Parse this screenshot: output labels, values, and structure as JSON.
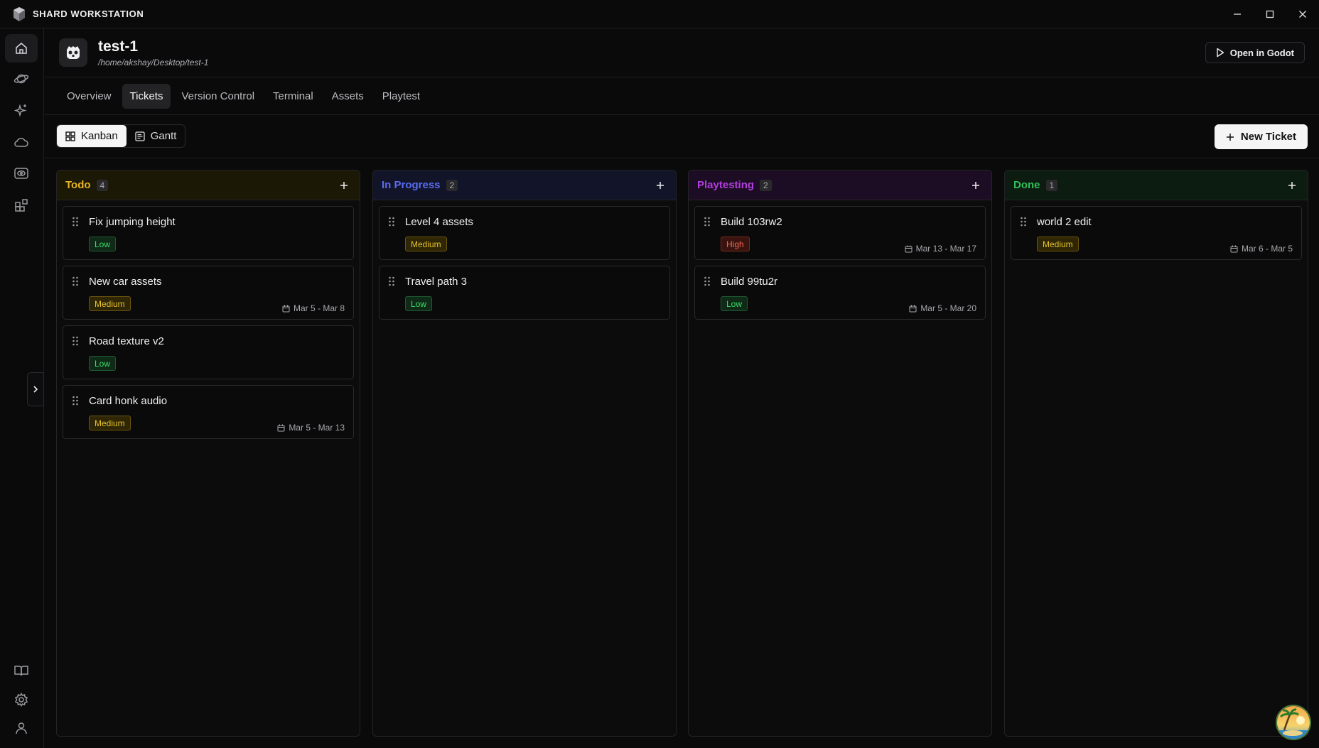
{
  "app": {
    "title": "SHARD WORKSTATION"
  },
  "project": {
    "name": "test-1",
    "path": "/home/akshay/Desktop/test-1",
    "open_label": "Open in Godot"
  },
  "tabs": [
    {
      "label": "Overview",
      "active": false
    },
    {
      "label": "Tickets",
      "active": true
    },
    {
      "label": "Version Control",
      "active": false
    },
    {
      "label": "Terminal",
      "active": false
    },
    {
      "label": "Assets",
      "active": false
    },
    {
      "label": "Playtest",
      "active": false
    }
  ],
  "views": {
    "kanban": "Kanban",
    "gantt": "Gantt",
    "active": "Kanban"
  },
  "new_ticket_label": "New Ticket",
  "colors": {
    "todo": "#e6b422",
    "in_progress": "#5a6cf0",
    "playtesting": "#b13ee0",
    "done": "#2fbf5a",
    "todo_bg": "#1c1806",
    "in_progress_bg": "#12142a",
    "playtesting_bg": "#1d0d24",
    "done_bg": "#0c1c11"
  },
  "columns": [
    {
      "title": "Todo",
      "count": "4",
      "cards": [
        {
          "title": "Fix jumping height",
          "priority": "Low",
          "dates": ""
        },
        {
          "title": "New car assets",
          "priority": "Medium",
          "dates": "Mar 5 - Mar 8"
        },
        {
          "title": "Road texture v2",
          "priority": "Low",
          "dates": ""
        },
        {
          "title": "Card honk audio",
          "priority": "Medium",
          "dates": "Mar 5 - Mar 13"
        }
      ]
    },
    {
      "title": "In Progress",
      "count": "2",
      "cards": [
        {
          "title": "Level 4 assets",
          "priority": "Medium",
          "dates": ""
        },
        {
          "title": "Travel path 3",
          "priority": "Low",
          "dates": ""
        }
      ]
    },
    {
      "title": "Playtesting",
      "count": "2",
      "cards": [
        {
          "title": "Build 103rw2",
          "priority": "High",
          "dates": "Mar 13 - Mar 17"
        },
        {
          "title": "Build 99tu2r",
          "priority": "Low",
          "dates": "Mar 5 - Mar 20"
        }
      ]
    },
    {
      "title": "Done",
      "count": "1",
      "cards": [
        {
          "title": "world 2 edit",
          "priority": "Medium",
          "dates": "Mar 6 - Mar 5"
        }
      ]
    }
  ]
}
